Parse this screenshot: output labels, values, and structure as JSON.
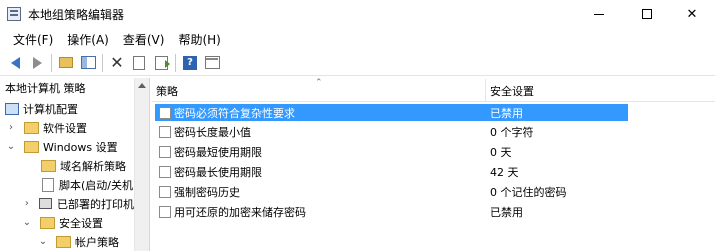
{
  "window": {
    "title": "本地组策略编辑器"
  },
  "menu": [
    "文件(F)",
    "操作(A)",
    "查看(V)",
    "帮助(H)"
  ],
  "toolbar": {
    "icons": [
      "back-arrow-icon",
      "forward-arrow-icon",
      "folder-up-icon",
      "show-pane-icon",
      "delete-icon",
      "properties-page-icon",
      "export-list-icon",
      "help-icon",
      "view-icon"
    ],
    "help_glyph": "?"
  },
  "tree": {
    "header": "本地计算机 策略",
    "items": [
      {
        "label": "计算机配置",
        "expander": ""
      },
      {
        "label": "软件设置",
        "expander": "›"
      },
      {
        "label": "Windows 设置",
        "expander": "⌄"
      },
      {
        "label": "域名解析策略",
        "expander": ""
      },
      {
        "label": "脚本(启动/关机",
        "expander": ""
      },
      {
        "label": "已部署的打印机",
        "expander": "›"
      },
      {
        "label": "安全设置",
        "expander": "⌄"
      },
      {
        "label": "帐户策略",
        "expander": "⌄"
      }
    ]
  },
  "list": {
    "columns": {
      "policy": "策略",
      "setting": "安全设置"
    },
    "rows": [
      {
        "policy": "密码必须符合复杂性要求",
        "setting": "已禁用",
        "selected": true
      },
      {
        "policy": "密码长度最小值",
        "setting": "0 个字符",
        "selected": false
      },
      {
        "policy": "密码最短使用期限",
        "setting": "0 天",
        "selected": false
      },
      {
        "policy": "密码最长使用期限",
        "setting": "42 天",
        "selected": false
      },
      {
        "policy": "强制密码历史",
        "setting": "0 个记住的密码",
        "selected": false
      },
      {
        "policy": "用可还原的加密来储存密码",
        "setting": "已禁用",
        "selected": false
      }
    ]
  },
  "colors": {
    "selection": "#3399ff",
    "toolbar_blue": "#3a73c4"
  }
}
